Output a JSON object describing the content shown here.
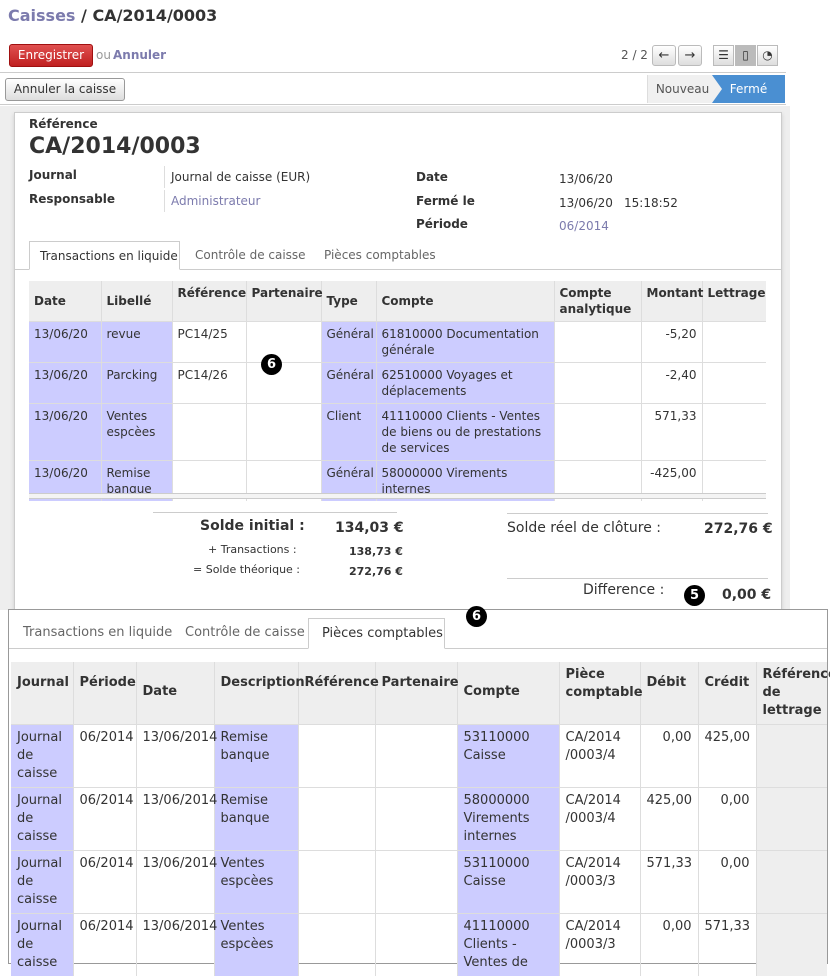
{
  "breadcrumb": {
    "parent": "Caisses",
    "separator": " / ",
    "current": "CA/2014/0003"
  },
  "toolbar": {
    "save_label": "Enregistrer",
    "or_text": "ou",
    "cancel_label": "Annuler",
    "pager_text": "2 / 2"
  },
  "actions": {
    "cancel_caisse_label": "Annuler la caisse"
  },
  "statusbar": {
    "states": [
      "Nouveau",
      "Fermé"
    ],
    "active": "Fermé"
  },
  "form": {
    "reference_label": "Référence",
    "reference_value": "CA/2014/0003",
    "journal_label": "Journal",
    "journal_value": "Journal de caisse (EUR)",
    "responsable_label": "Responsable",
    "responsable_value": "Administrateur",
    "date_label": "Date",
    "date_value": "13/06/20",
    "ferme_label": "Fermé le",
    "ferme_date": "13/06/20",
    "ferme_time": "15:18:52",
    "periode_label": "Période",
    "periode_value": "06/2014"
  },
  "tabs1": [
    "Transactions en liquide",
    "Contrôle de caisse",
    "Pièces comptables"
  ],
  "tabs1_active": "Transactions en liquide",
  "transactions": {
    "headers": [
      "Date",
      "Libellé",
      "Référence",
      "Partenaire",
      "Type",
      "Compte",
      "Compte analytique",
      "Montant",
      "Lettrage"
    ],
    "rows": [
      {
        "date": "13/06/20",
        "libelle": "revue",
        "reference": "PC14/25",
        "partenaire": "",
        "type": "Général",
        "compte": "61810000 Documentation générale",
        "analytique": "",
        "montant": "-5,20",
        "lettrage": ""
      },
      {
        "date": "13/06/20",
        "libelle": "Parcking",
        "reference": "PC14/26",
        "partenaire": "",
        "type": "Général",
        "compte": "62510000 Voyages et déplacements",
        "analytique": "",
        "montant": "-2,40",
        "lettrage": ""
      },
      {
        "date": "13/06/20",
        "libelle": "Ventes espcèes",
        "reference": "",
        "partenaire": "",
        "type": "Client",
        "compte": "41110000 Clients - Ventes de biens ou de prestations de services",
        "analytique": "",
        "montant": "571,33",
        "lettrage": ""
      },
      {
        "date": "13/06/20",
        "libelle": "Remise banque",
        "reference": "",
        "partenaire": "",
        "type": "Général",
        "compte": "58000000 Virements internes",
        "analytique": "",
        "montant": "-425,00",
        "lettrage": ""
      }
    ]
  },
  "summary": {
    "solde_initial_label": "Solde initial :",
    "solde_initial_value": "134,03 €",
    "transactions_label": "+ Transactions :",
    "transactions_value": "138,73 €",
    "solde_theorique_label": "= Solde théorique :",
    "solde_theorique_value": "272,76 €",
    "cloture_label": "Solde réel de clôture :",
    "cloture_value": "272,76 €",
    "difference_label": "Difference :",
    "difference_value": "0,00 €"
  },
  "badges": {
    "five": "5",
    "six": "6"
  },
  "tabs2": [
    "Transactions en liquide",
    "Contrôle de caisse",
    "Pièces comptables"
  ],
  "tabs2_active": "Pièces comptables",
  "pieces": {
    "headers": [
      "Journal",
      "Période",
      "Date",
      "Description",
      "Référence",
      "Partenaire",
      "Compte",
      "Pièce comptable",
      "Débit",
      "Crédit",
      "Référence de lettrage"
    ],
    "rows": [
      {
        "journal": "Journal de caisse",
        "periode": "06/2014",
        "date": "13/06/2014",
        "description": "Remise banque",
        "reference": "",
        "partenaire": "",
        "compte": "53110000 Caisse",
        "piece": "CA/2014 /0003/4",
        "debit": "0,00",
        "credit": "425,00",
        "lettrage": ""
      },
      {
        "journal": "Journal de caisse",
        "periode": "06/2014",
        "date": "13/06/2014",
        "description": "Remise banque",
        "reference": "",
        "partenaire": "",
        "compte": "58000000 Virements internes",
        "piece": "CA/2014 /0003/4",
        "debit": "425,00",
        "credit": "0,00",
        "lettrage": ""
      },
      {
        "journal": "Journal de caisse",
        "periode": "06/2014",
        "date": "13/06/2014",
        "description": "Ventes espcèes",
        "reference": "",
        "partenaire": "",
        "compte": "53110000 Caisse",
        "piece": "CA/2014 /0003/3",
        "debit": "571,33",
        "credit": "0,00",
        "lettrage": ""
      },
      {
        "journal": "Journal de caisse",
        "periode": "06/2014",
        "date": "13/06/2014",
        "description": "Ventes espcèes",
        "reference": "",
        "partenaire": "",
        "compte": "41110000 Clients - Ventes de",
        "piece": "CA/2014 /0003/3",
        "debit": "0,00",
        "credit": "571,33",
        "lettrage": ""
      }
    ]
  },
  "colors": {
    "accent": "#7c7bad",
    "save": "#d03030",
    "status_active": "#4a8fd2",
    "highlight": "#ccccff"
  }
}
